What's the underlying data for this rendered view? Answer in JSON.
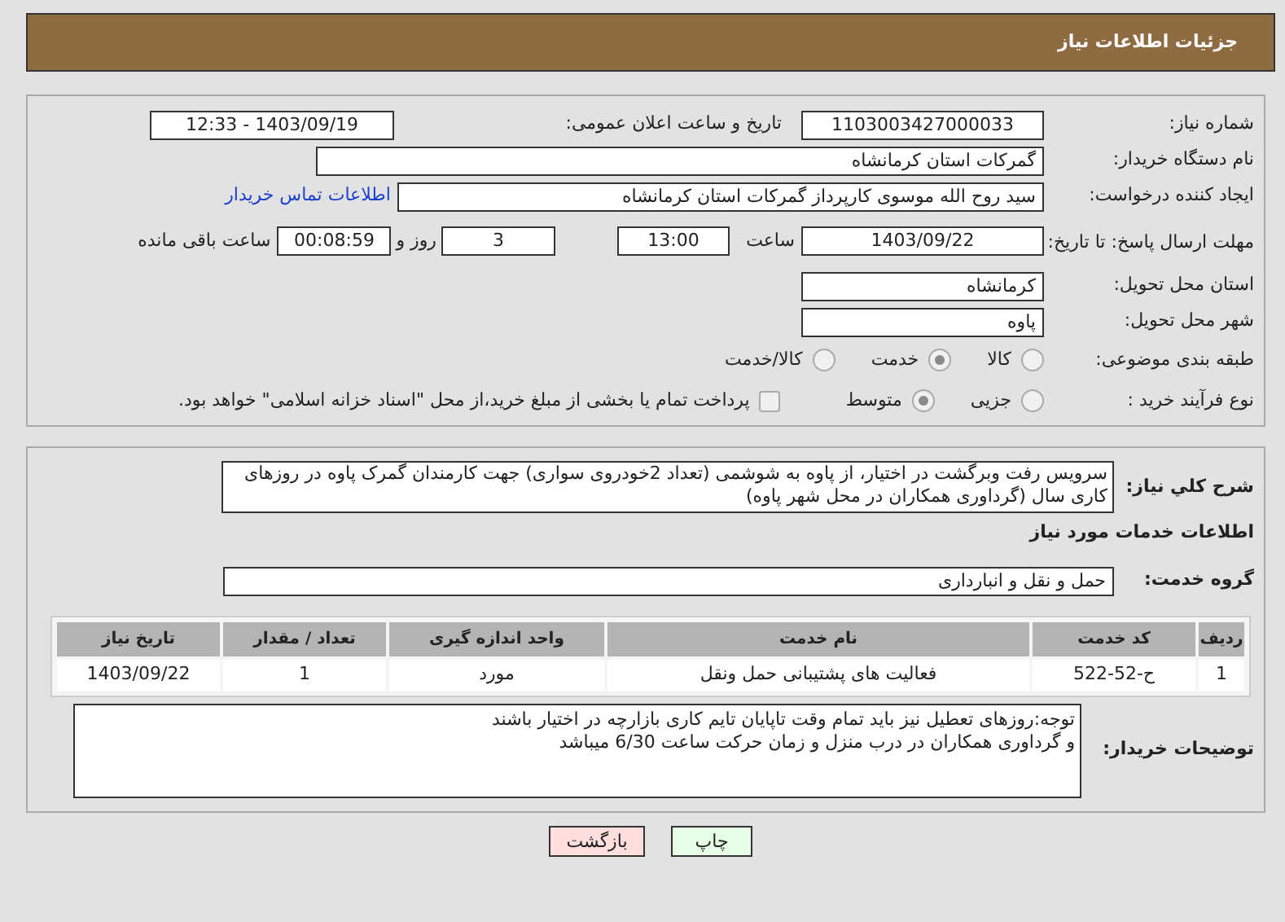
{
  "header": {
    "title": "جزئیات اطلاعات نیاز"
  },
  "need_number": {
    "label": "شماره نیاز:",
    "value": "1103003427000033"
  },
  "announce": {
    "label": "تاریخ و ساعت اعلان عمومی:",
    "value": "1403/09/19 - 12:33"
  },
  "buyer_org": {
    "label": "نام دستگاه خریدار:",
    "value": "گمرکات استان کرمانشاه"
  },
  "requester": {
    "label": "ایجاد کننده درخواست:",
    "value": "سید روح الله موسوی کارپرداز گمرکات استان کرمانشاه",
    "link": "اطلاعات تماس خریدار"
  },
  "deadline": {
    "label": "مهلت ارسال پاسخ: تا تاریخ:",
    "date": "1403/09/22",
    "time_label": "ساعت",
    "time": "13:00",
    "days": "3",
    "days_label": "روز و",
    "remaining": "00:08:59",
    "remaining_label": "ساعت باقی مانده"
  },
  "province": {
    "label": "استان محل تحویل:",
    "value": "کرمانشاه"
  },
  "city": {
    "label": "شهر محل تحویل:",
    "value": "پاوه"
  },
  "category": {
    "label": "طبقه بندی موضوعی:",
    "options": [
      {
        "label": "کالا",
        "selected": false
      },
      {
        "label": "خدمت",
        "selected": true
      },
      {
        "label": "کالا/خدمت",
        "selected": false
      }
    ]
  },
  "process": {
    "label": "نوع فرآیند خرید :",
    "options": [
      {
        "label": "جزیی",
        "selected": false
      },
      {
        "label": "متوسط",
        "selected": true
      }
    ],
    "payment": {
      "checked": false,
      "text": "پرداخت تمام یا بخشی از مبلغ خرید،از محل \"اسناد خزانه اسلامی\" خواهد بود."
    }
  },
  "description": {
    "label": "شرح کلي نياز:",
    "value": "سرویس رفت وبرگشت در اختیار، از پاوه به شوشمی (تعداد 2خودروی سواری) جهت کارمندان گمرک پاوه در روزهای کاری سال (گرداوری همکاران در محل شهر پاوه)"
  },
  "services_title": "اطلاعات خدمات مورد نیاز",
  "service_group": {
    "label": "گروه خدمت:",
    "value": "حمل و نقل و انبارداری"
  },
  "table": {
    "columns": [
      "ردیف",
      "کد خدمت",
      "نام خدمت",
      "واحد اندازه گیری",
      "تعداد / مقدار",
      "تاریخ نیاز"
    ],
    "rows": [
      [
        "1",
        "ح-52-522",
        "فعالیت های پشتیبانی حمل ونقل",
        "مورد",
        "1",
        "1403/09/22"
      ]
    ]
  },
  "buyer_notes": {
    "label": "توضیحات خریدار:",
    "lines": [
      "توجه:روزهای تعطیل نیز باید تمام وقت تاپایان تایم کاری بازارچه در اختیار باشند",
      "و گرداوری همکاران در درب منزل و زمان حرکت ساعت 6/30 میباشد"
    ]
  },
  "buttons": [
    {
      "label": "چاپ",
      "kind": "print"
    },
    {
      "label": "بازگشت",
      "kind": "back"
    }
  ]
}
